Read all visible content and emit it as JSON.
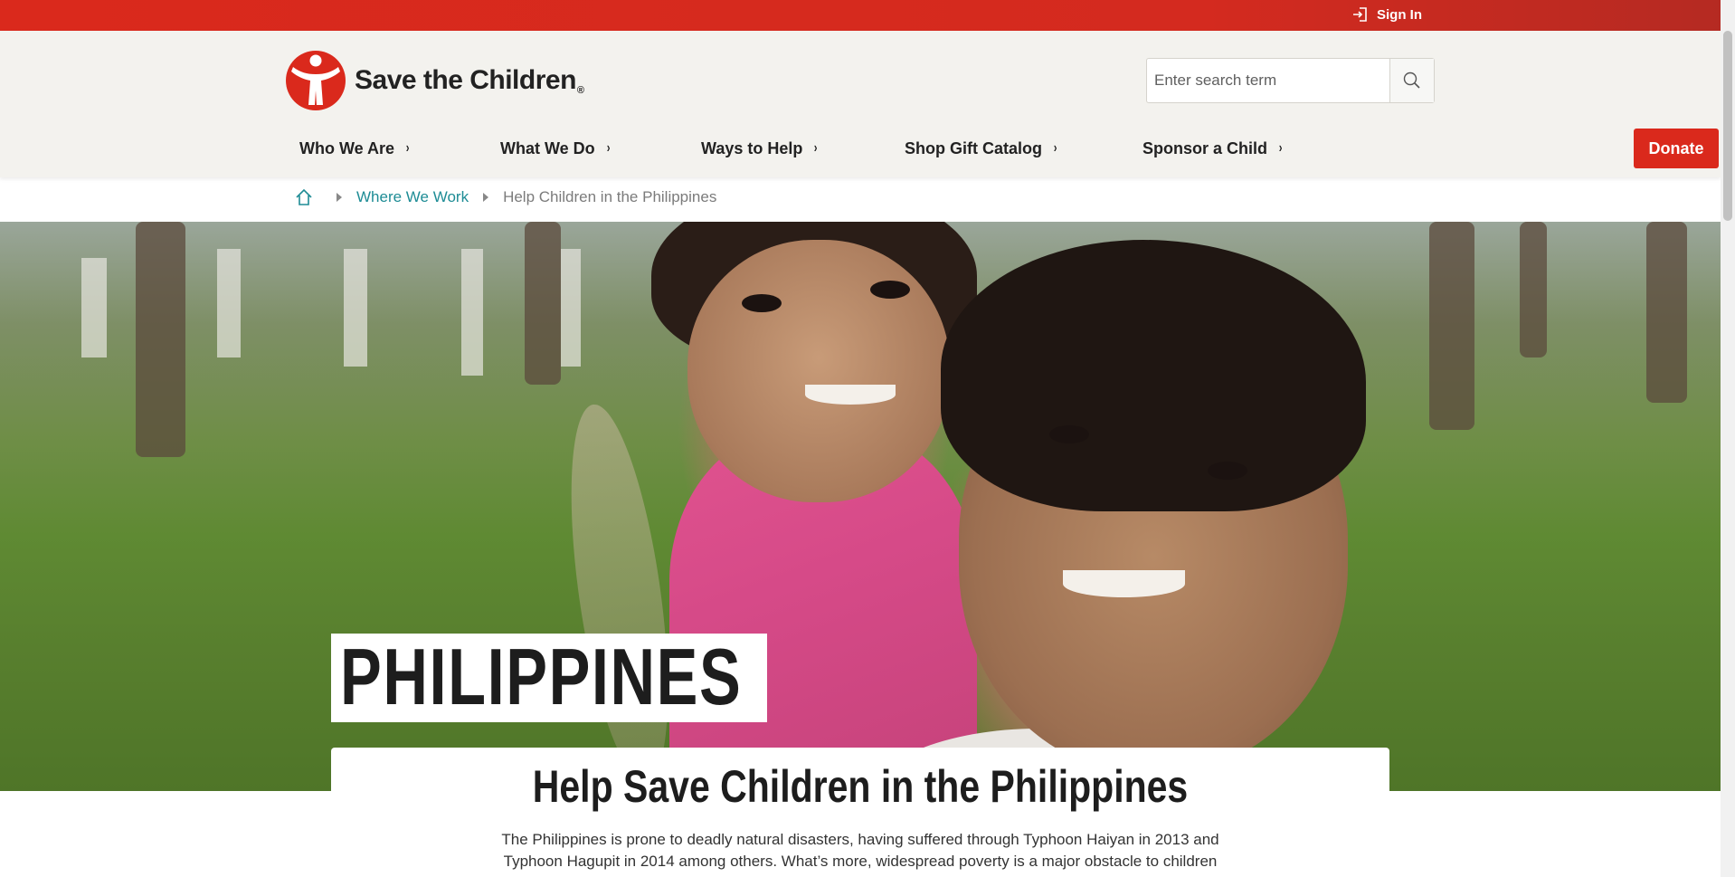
{
  "utility": {
    "signin_label": "Sign In",
    "signin_icon": "sign-in-icon"
  },
  "brand": {
    "name": "Save the Children",
    "registered_mark": "®",
    "color": "#da291c"
  },
  "search": {
    "placeholder": "Enter search term",
    "value": ""
  },
  "nav": {
    "items": [
      {
        "label": "Who We Are"
      },
      {
        "label": "What We Do"
      },
      {
        "label": "Ways to Help"
      },
      {
        "label": "Shop Gift Catalog"
      },
      {
        "label": "Sponsor a Child"
      }
    ],
    "chevron": "›",
    "donate_label": "Donate"
  },
  "breadcrumb": {
    "home_icon": "home-icon",
    "items": [
      {
        "label": "Where We Work"
      },
      {
        "label": "Help Children in the Philippines"
      }
    ]
  },
  "hero": {
    "title": "PHILIPPINES"
  },
  "intro": {
    "heading": "Help Save Children in the Philippines",
    "text": "The Philippines is prone to deadly natural disasters, having suffered through Typhoon Haiyan in 2013 and Typhoon Hagupit in 2014 among others. What’s more, widespread poverty is a major obstacle to children"
  },
  "colors": {
    "accent_red": "#da291c",
    "link_teal": "#1e8c95",
    "header_bg": "#f3f2ee"
  }
}
